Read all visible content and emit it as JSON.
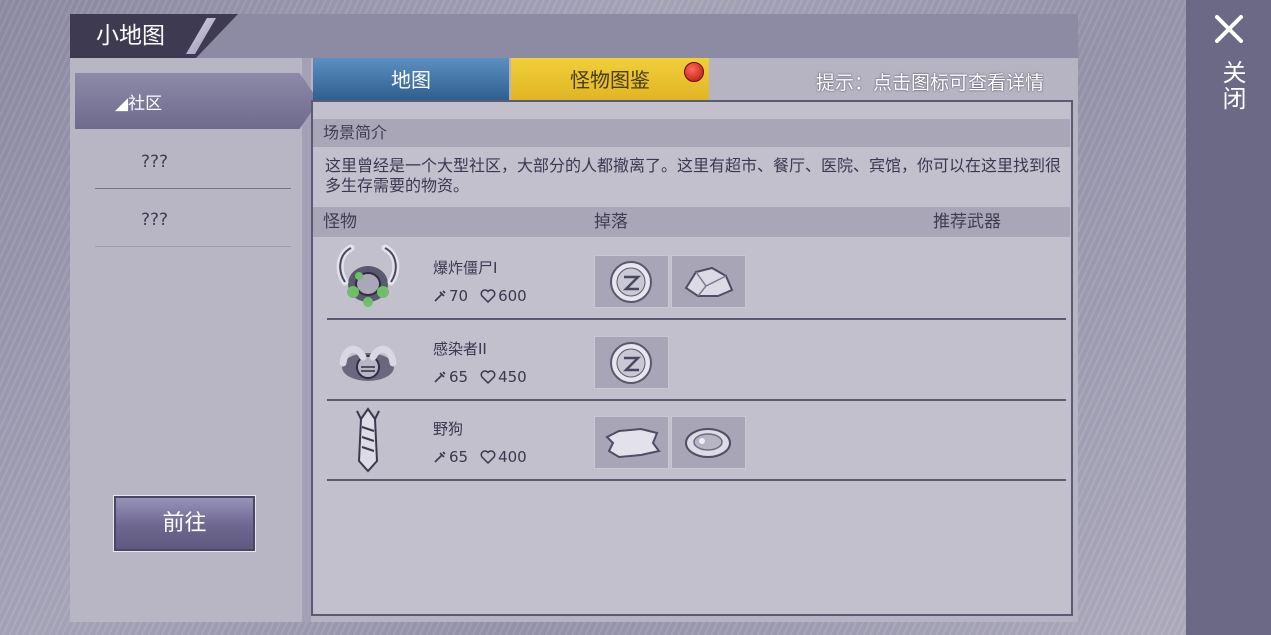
{
  "window": {
    "title": "小地图"
  },
  "close": {
    "label": "关闭",
    "icon": "close-icon"
  },
  "sidebar": {
    "category": "◢社区",
    "items": [
      {
        "label": "???"
      },
      {
        "label": "???"
      }
    ],
    "goto_label": "前往"
  },
  "tabs": [
    {
      "label": "地图",
      "active": false,
      "color": "#3f72a6"
    },
    {
      "label": "怪物图鉴",
      "active": true,
      "color": "#e6bd28",
      "badge": true
    }
  ],
  "hint": "提示：点击图标可查看详情",
  "scene": {
    "header": "场景简介",
    "description": "这里曾经是一个大型社区，大部分的人都撤离了。这里有超市、餐厅、医院、宾馆，你可以在这里找到很多生存需要的物资。"
  },
  "table": {
    "columns": [
      "怪物",
      "掉落",
      "推荐武器"
    ],
    "rows": [
      {
        "name": "爆炸僵尸I",
        "attack": "70",
        "hp": "600",
        "drops": [
          "coin-icon",
          "ore-icon"
        ]
      },
      {
        "name": "感染者II",
        "attack": "65",
        "hp": "450",
        "drops": [
          "coin-icon"
        ]
      },
      {
        "name": "野狗",
        "attack": "65",
        "hp": "400",
        "drops": [
          "hide-icon",
          "meat-icon"
        ]
      }
    ]
  }
}
